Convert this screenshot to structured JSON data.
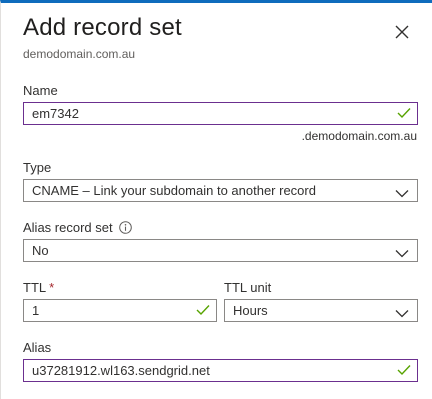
{
  "panel": {
    "title": "Add record set",
    "subtitle": "demodomain.com.au",
    "close_icon": "close-icon"
  },
  "form": {
    "name": {
      "label": "Name",
      "value": "em7342",
      "suffix": ".demodomain.com.au",
      "status_icon": "checkmark-icon"
    },
    "type": {
      "label": "Type",
      "value": "CNAME – Link your subdomain to another record",
      "icon": "chevron-down-icon"
    },
    "alias_record_set": {
      "label": "Alias record set",
      "info_icon": "info-icon",
      "value": "No",
      "icon": "chevron-down-icon"
    },
    "ttl": {
      "label": "TTL",
      "required_marker": "*",
      "value": "1",
      "status_icon": "checkmark-icon"
    },
    "ttl_unit": {
      "label": "TTL unit",
      "value": "Hours",
      "icon": "chevron-down-icon"
    },
    "alias": {
      "label": "Alias",
      "value": "u37281912.wl163.sendgrid.net",
      "status_icon": "checkmark-icon"
    }
  },
  "colors": {
    "accent_border": "#6b2f8f",
    "valid_check": "#57a300",
    "required": "#a4262c",
    "top_bar": "#0f6cbd"
  }
}
